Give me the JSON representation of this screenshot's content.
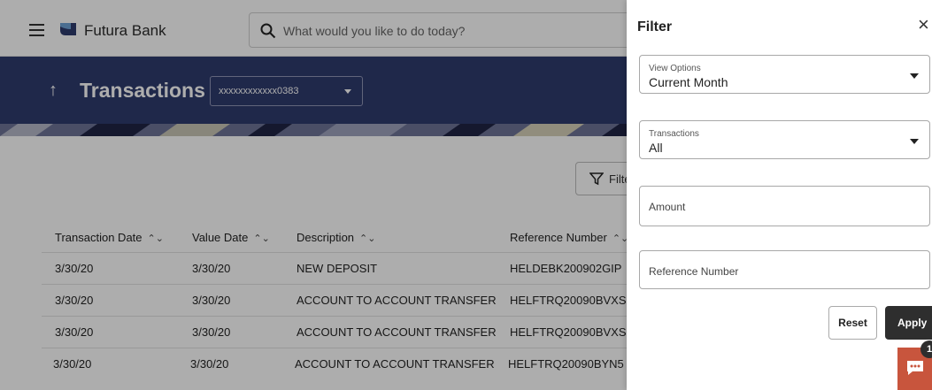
{
  "header": {
    "brand": "Futura Bank",
    "search_placeholder": "What would you like to do today?"
  },
  "banner": {
    "title": "Transactions",
    "account": "xxxxxxxxxxxx0383"
  },
  "toolbar": {
    "filter_label": "Filte"
  },
  "table": {
    "columns": [
      "Transaction Date",
      "Value Date",
      "Description",
      "Reference Number"
    ],
    "rows": [
      [
        "3/30/20",
        "3/30/20",
        "NEW DEPOSIT",
        "HELDEBK200902GIP"
      ],
      [
        "3/30/20",
        "3/30/20",
        "ACCOUNT TO ACCOUNT TRANSFER",
        "HELFTRQ20090BVXS"
      ],
      [
        "3/30/20",
        "3/30/20",
        "ACCOUNT TO ACCOUNT TRANSFER",
        "HELFTRQ20090BVXS"
      ],
      [
        "3/30/20",
        "3/30/20",
        "ACCOUNT TO ACCOUNT TRANSFER",
        "HELFTRQ20090BYN5"
      ]
    ]
  },
  "filter_panel": {
    "title": "Filter",
    "view_options": {
      "label": "View Options",
      "value": "Current Month"
    },
    "transactions": {
      "label": "Transactions",
      "value": "All"
    },
    "amount_placeholder": "Amount",
    "reference_placeholder": "Reference Number",
    "reset_label": "Reset",
    "apply_label": "Apply"
  },
  "chat": {
    "badge": "1"
  },
  "icons": {
    "menu": "hamburger-menu-icon",
    "logo": "futura-bank-logo",
    "search": "search-icon",
    "back": "up-arrow-icon",
    "filter": "funnel-icon",
    "sort": "sort-chevrons-icon",
    "close": "close-icon",
    "chat": "chat-bubble-icon"
  },
  "colors": {
    "banner": "#2f3b6e",
    "apply_button": "#2e2e2e",
    "chat_button": "#c8553d"
  }
}
